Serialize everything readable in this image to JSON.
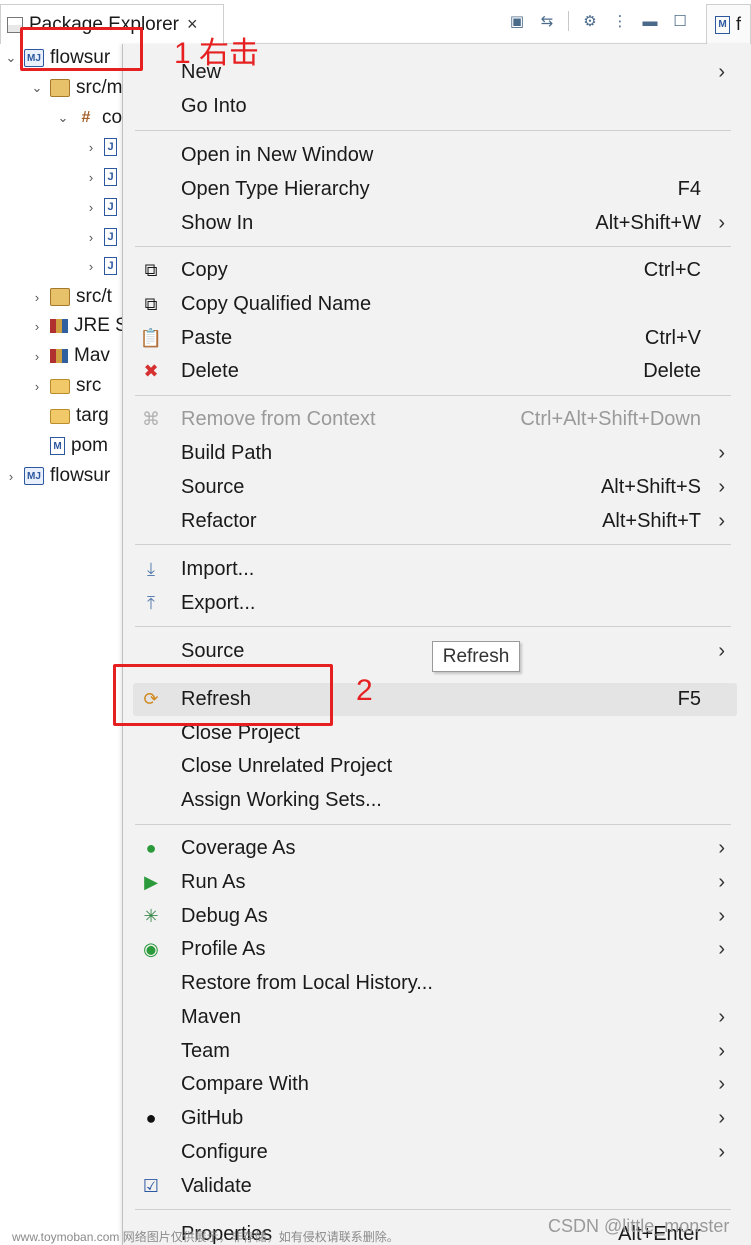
{
  "panel": {
    "tab_title": "Package Explorer",
    "tab_close": "×",
    "second_tab_label": "f",
    "toolbar_icons": [
      "collapse-all-icon",
      "link-with-editor-icon",
      "filter-icon",
      "view-menu-icon",
      "minimize-icon",
      "maximize-icon"
    ]
  },
  "tree": {
    "project_name": "flowsur",
    "src_main": "src/m",
    "package": "co",
    "src_test": "src/t",
    "jre": "JRE S",
    "maven": "Mav",
    "src": "src",
    "target": "targ",
    "pom": "pom",
    "project2_name": "flowsur"
  },
  "menu": {
    "items": [
      {
        "label": "New",
        "accel": "",
        "submenu": true
      },
      {
        "label": "Go Into",
        "accel": "",
        "submenu": false
      },
      {
        "label": "Open in New Window",
        "accel": "",
        "submenu": false
      },
      {
        "label": "Open Type Hierarchy",
        "accel": "F4",
        "submenu": false
      },
      {
        "label": "Show In",
        "accel": "Alt+Shift+W",
        "submenu": true
      },
      {
        "label": "Copy",
        "accel": "Ctrl+C",
        "submenu": false
      },
      {
        "label": "Copy Qualified Name",
        "accel": "",
        "submenu": false
      },
      {
        "label": "Paste",
        "accel": "Ctrl+V",
        "submenu": false
      },
      {
        "label": "Delete",
        "accel": "Delete",
        "submenu": false
      },
      {
        "label": "Remove from Context",
        "accel": "Ctrl+Alt+Shift+Down",
        "submenu": false,
        "disabled": true
      },
      {
        "label": "Build Path",
        "accel": "",
        "submenu": true
      },
      {
        "label": "Source",
        "accel": "Alt+Shift+S",
        "submenu": true
      },
      {
        "label": "Refactor",
        "accel": "Alt+Shift+T",
        "submenu": true
      },
      {
        "label": "Import...",
        "accel": "",
        "submenu": false
      },
      {
        "label": "Export...",
        "accel": "",
        "submenu": false
      },
      {
        "label": "Source",
        "accel": "",
        "submenu": true
      },
      {
        "label": "Refresh",
        "accel": "F5",
        "submenu": false
      },
      {
        "label": "Close Project",
        "accel": "",
        "submenu": false
      },
      {
        "label": "Close Unrelated Project",
        "accel": "",
        "submenu": false
      },
      {
        "label": "Assign Working Sets...",
        "accel": "",
        "submenu": false
      },
      {
        "label": "Coverage As",
        "accel": "",
        "submenu": true
      },
      {
        "label": "Run As",
        "accel": "",
        "submenu": true
      },
      {
        "label": "Debug As",
        "accel": "",
        "submenu": true
      },
      {
        "label": "Profile As",
        "accel": "",
        "submenu": true
      },
      {
        "label": "Restore from Local History...",
        "accel": "",
        "submenu": false
      },
      {
        "label": "Maven",
        "accel": "",
        "submenu": true
      },
      {
        "label": "Team",
        "accel": "",
        "submenu": true
      },
      {
        "label": "Compare With",
        "accel": "",
        "submenu": true
      },
      {
        "label": "GitHub",
        "accel": "",
        "submenu": true
      },
      {
        "label": "Configure",
        "accel": "",
        "submenu": true
      },
      {
        "label": "Validate",
        "accel": "",
        "submenu": false
      },
      {
        "label": "Properties",
        "accel": "Alt+Enter",
        "submenu": false
      }
    ],
    "arrow": "›",
    "tooltip": "Refresh"
  },
  "annotations": {
    "step1": "1 右击",
    "step2": "2",
    "color": "#e62020"
  },
  "watermark": {
    "left": "www.toymoban.com 网络图片仅供展示，非存储，如有侵权请联系删除。",
    "right": "CSDN @little_monster"
  }
}
